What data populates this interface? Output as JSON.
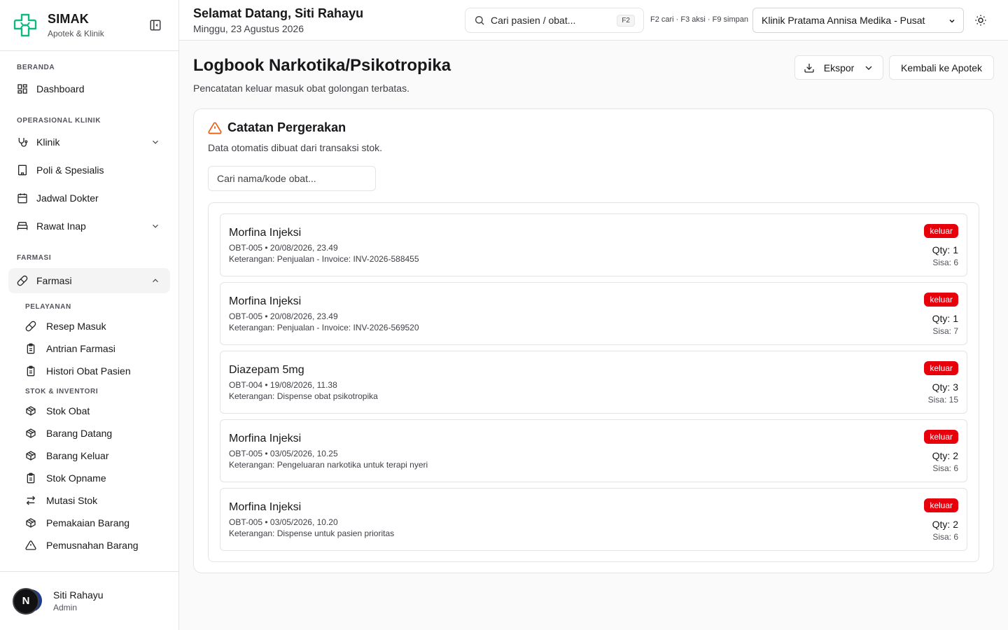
{
  "brand": {
    "name": "SIMAK",
    "subtitle": "Apotek & Klinik"
  },
  "sidebar": {
    "sections": {
      "beranda": "BERANDA",
      "operasional": "OPERASIONAL KLINIK",
      "farmasi": "FARMASI"
    },
    "items": {
      "dashboard": "Dashboard",
      "klinik": "Klinik",
      "poli": "Poli & Spesialis",
      "jadwal": "Jadwal Dokter",
      "rawat_inap": "Rawat Inap",
      "farmasi": "Farmasi"
    },
    "sub_sections": {
      "pelayanan": "PELAYANAN",
      "stok": "STOK & INVENTORI"
    },
    "sub_items": {
      "resep_masuk": "Resep Masuk",
      "antrian": "Antrian Farmasi",
      "histori": "Histori Obat Pasien",
      "stok_obat": "Stok Obat",
      "barang_datang": "Barang Datang",
      "barang_keluar": "Barang Keluar",
      "stok_opname": "Stok Opname",
      "mutasi": "Mutasi Stok",
      "pemakaian": "Pemakaian Barang",
      "pemusnahan": "Pemusnahan Barang"
    }
  },
  "user": {
    "initial": "N",
    "name": "Siti Rahayu",
    "role": "Admin"
  },
  "topbar": {
    "greeting": "Selamat Datang, Siti Rahayu",
    "date": "Minggu, 23 Agustus 2026",
    "search_placeholder": "Cari pasien / obat...",
    "search_kbd": "F2",
    "hotkeys": "F2 cari · F3 aksi · F9 simpan",
    "clinic": "Klinik Pratama Annisa Medika - Pusat"
  },
  "page": {
    "title": "Logbook Narkotika/Psikotropika",
    "subtitle": "Pencatatan keluar masuk obat golongan terbatas.",
    "export_label": "Ekspor",
    "back_label": "Kembali ke Apotek"
  },
  "card": {
    "title": "Catatan Pergerakan",
    "subtitle": "Data otomatis dibuat dari transaksi stok.",
    "filter_placeholder": "Cari nama/kode obat...",
    "logs": [
      {
        "name": "Morfina Injeksi",
        "meta": "OBT-005 • 20/08/2026, 23.49",
        "note": "Keterangan: Penjualan - Invoice: INV-2026-588455",
        "type": "keluar",
        "qty": "Qty: 1",
        "sisa": "Sisa: 6"
      },
      {
        "name": "Morfina Injeksi",
        "meta": "OBT-005 • 20/08/2026, 23.49",
        "note": "Keterangan: Penjualan - Invoice: INV-2026-569520",
        "type": "keluar",
        "qty": "Qty: 1",
        "sisa": "Sisa: 7"
      },
      {
        "name": "Diazepam 5mg",
        "meta": "OBT-004 • 19/08/2026, 11.38",
        "note": "Keterangan: Dispense obat psikotropika",
        "type": "keluar",
        "qty": "Qty: 3",
        "sisa": "Sisa: 15"
      },
      {
        "name": "Morfina Injeksi",
        "meta": "OBT-005 • 03/05/2026, 10.25",
        "note": "Keterangan: Pengeluaran narkotika untuk terapi nyeri",
        "type": "keluar",
        "qty": "Qty: 2",
        "sisa": "Sisa: 6"
      },
      {
        "name": "Morfina Injeksi",
        "meta": "OBT-005 • 03/05/2026, 10.20",
        "note": "Keterangan: Dispense untuk pasien prioritas",
        "type": "keluar",
        "qty": "Qty: 2",
        "sisa": "Sisa: 6"
      }
    ]
  },
  "colors": {
    "brand": "#10b981",
    "badge": "#e7000b",
    "warning": "#ea580c"
  }
}
